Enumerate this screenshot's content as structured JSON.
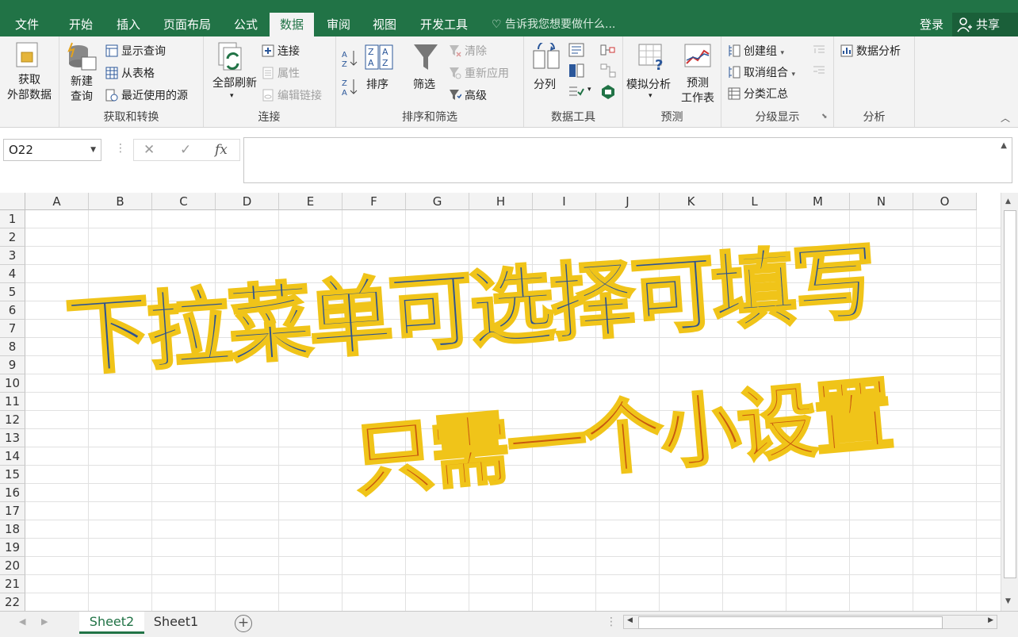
{
  "tabs": [
    {
      "label": "文件",
      "active": false
    },
    {
      "label": "开始",
      "active": false
    },
    {
      "label": "插入",
      "active": false
    },
    {
      "label": "页面布局",
      "active": false
    },
    {
      "label": "公式",
      "active": false
    },
    {
      "label": "数据",
      "active": true
    },
    {
      "label": "审阅",
      "active": false
    },
    {
      "label": "视图",
      "active": false
    },
    {
      "label": "开发工具",
      "active": false
    }
  ],
  "tell_me": "告诉我您想要做什么...",
  "account": {
    "login": "登录",
    "share": "共享"
  },
  "ribbon": {
    "get_external": "获取\n外部数据",
    "new_query": "新建\n查询",
    "show_query": "显示查询",
    "from_table": "从表格",
    "recent_sources": "最近使用的源",
    "group_get_transform": "获取和转换",
    "refresh_all": "全部刷新",
    "connections": "连接",
    "properties": "属性",
    "edit_links": "编辑链接",
    "group_connections": "连接",
    "sort": "排序",
    "filter": "筛选",
    "clear": "清除",
    "reapply": "重新应用",
    "advanced": "高级",
    "group_sort_filter": "排序和筛选",
    "text_to_columns": "分列",
    "group_data_tools": "数据工具",
    "what_if": "模拟分析",
    "forecast_sheet": "预测\n工作表",
    "group_forecast": "预测",
    "group_btn": "创建组",
    "ungroup_btn": "取消组合",
    "subtotal": "分类汇总",
    "group_outline": "分级显示",
    "data_analysis": "数据分析",
    "group_analysis": "分析"
  },
  "namebox": "O22",
  "columns": [
    "A",
    "B",
    "C",
    "D",
    "E",
    "F",
    "G",
    "H",
    "I",
    "J",
    "K",
    "L",
    "M",
    "N",
    "O"
  ],
  "rows": [
    "1",
    "2",
    "3",
    "4",
    "5",
    "6",
    "7",
    "8",
    "9",
    "10",
    "11",
    "12",
    "13",
    "14",
    "15",
    "16",
    "17",
    "18",
    "19",
    "20",
    "21",
    "22"
  ],
  "overlay": {
    "line1": "下拉菜单可选择可填写",
    "line2": "只需一个小设置"
  },
  "sheets": [
    {
      "label": "Sheet2",
      "active": true
    },
    {
      "label": "Sheet1",
      "active": false
    }
  ],
  "colors": {
    "excel_green": "#217346",
    "overlay_blue": "#2c5291",
    "overlay_orange": "#c8590f",
    "outline_yellow": "#f0c419"
  }
}
